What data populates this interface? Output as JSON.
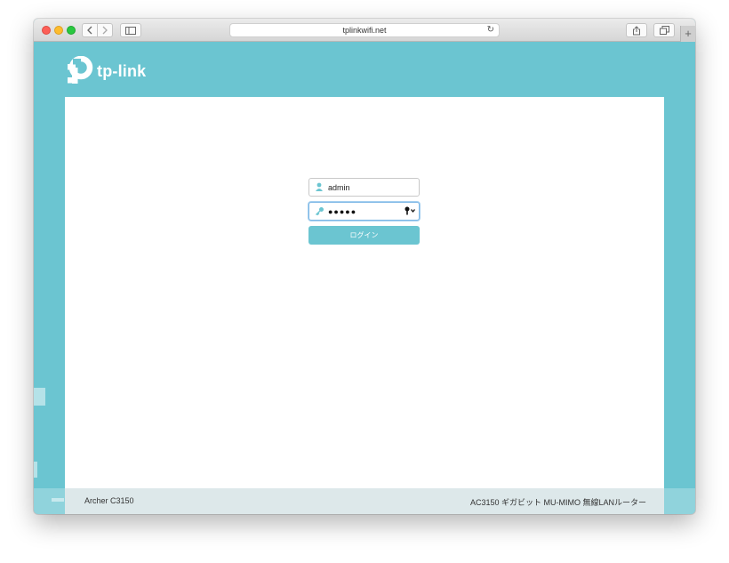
{
  "browser": {
    "url": "tplinkwifi.net",
    "new_tab_label": "+"
  },
  "brand": {
    "name": "tp-link",
    "accent_color": "#6bc5d1"
  },
  "login": {
    "username_value": "admin",
    "password_mask": "●●●●●",
    "submit_label": "ログイン"
  },
  "footer": {
    "model": "Archer C3150",
    "description": "AC3150 ギガビット MU-MIMO 無線LANルーター"
  },
  "icons": {
    "username": "user-icon",
    "password": "key-icon",
    "keychain": "keychain-icon"
  }
}
